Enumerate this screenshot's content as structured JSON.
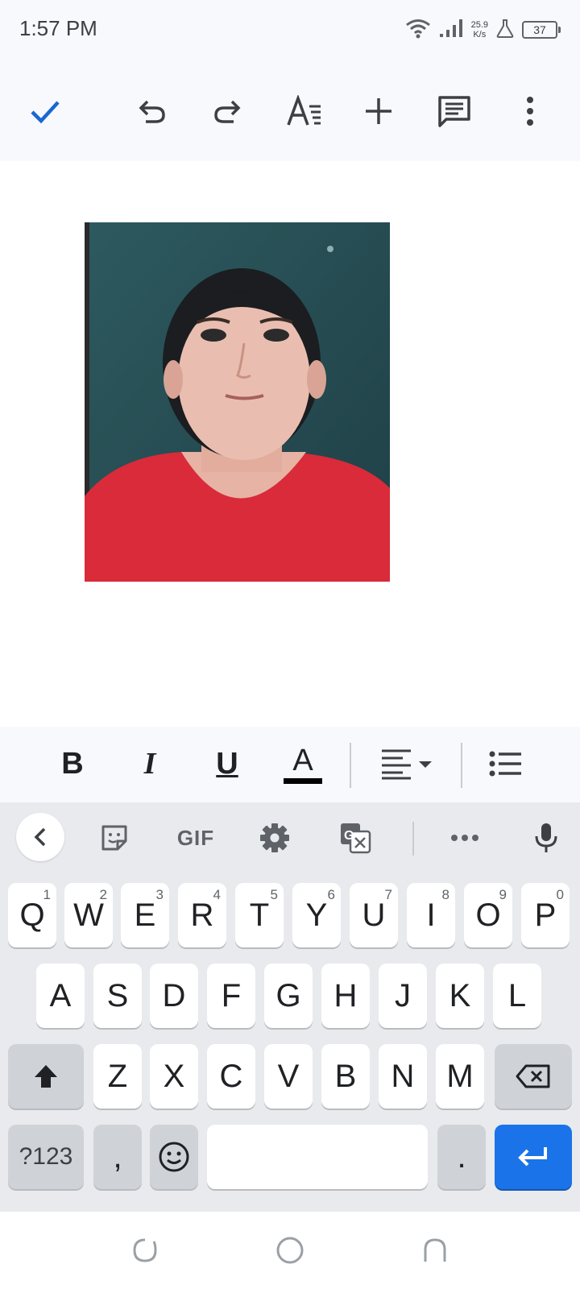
{
  "status_bar": {
    "time": "1:57 PM",
    "net_speed_value": "25.9",
    "net_speed_unit": "K/s",
    "battery": "37"
  },
  "toolbar": {
    "icons": [
      "check-icon",
      "undo-icon",
      "redo-icon",
      "text-format-icon",
      "insert-icon",
      "comment-icon",
      "more-icon"
    ],
    "accent_color": "#1967d2"
  },
  "document": {
    "image": "portrait-photo"
  },
  "format_bar": {
    "bold": "B",
    "italic": "I",
    "underline": "U",
    "text_color": "A",
    "text_color_swatch": "#000000"
  },
  "keyboard": {
    "suggestion_bar": {
      "gif_label": "GIF",
      "icons": [
        "back-chevron-icon",
        "sticker-icon",
        "gif-icon",
        "settings-icon",
        "translate-icon",
        "more-horiz-icon",
        "mic-icon"
      ]
    },
    "row1": [
      {
        "key": "Q",
        "hint": "1"
      },
      {
        "key": "W",
        "hint": "2"
      },
      {
        "key": "E",
        "hint": "3"
      },
      {
        "key": "R",
        "hint": "4"
      },
      {
        "key": "T",
        "hint": "5"
      },
      {
        "key": "Y",
        "hint": "6"
      },
      {
        "key": "U",
        "hint": "7"
      },
      {
        "key": "I",
        "hint": "8"
      },
      {
        "key": "O",
        "hint": "9"
      },
      {
        "key": "P",
        "hint": "0"
      }
    ],
    "row2": [
      "A",
      "S",
      "D",
      "F",
      "G",
      "H",
      "J",
      "K",
      "L"
    ],
    "row3": [
      "Z",
      "X",
      "C",
      "V",
      "B",
      "N",
      "M"
    ],
    "row4": {
      "symbols": "?123",
      "comma": ",",
      "period": "."
    },
    "enter_color": "#1a73e8"
  },
  "nav_bar": {
    "icons": [
      "recents-icon",
      "home-icon",
      "back-icon"
    ]
  }
}
